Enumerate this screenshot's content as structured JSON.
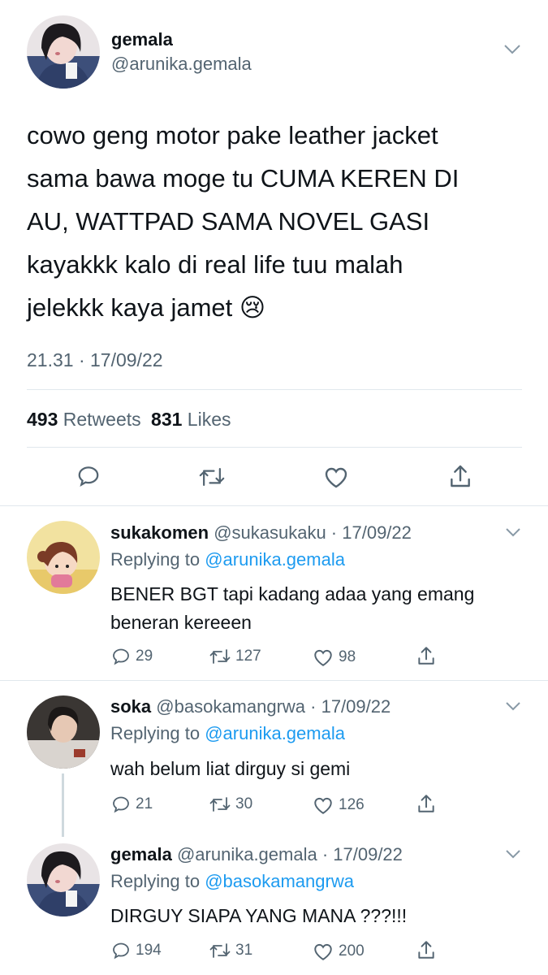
{
  "main_tweet": {
    "display_name": "gemala",
    "handle": "@arunika.gemala",
    "text_lines": [
      "cowo geng motor pake leather jacket",
      "sama bawa moge tu CUMA KEREN DI",
      "AU, WATTPAD SAMA NOVEL GASI",
      "kayakkk kalo di real life tuu malah",
      "jelekkk kaya jamet 😢"
    ],
    "timestamp": "21.31 · 17/09/22",
    "retweets_count": "493",
    "retweets_label": "Retweets",
    "likes_count": "831",
    "likes_label": "Likes",
    "icons": [
      "reply-icon",
      "retweet-icon",
      "like-icon",
      "share-icon"
    ]
  },
  "replies": [
    {
      "display_name": "sukakomen",
      "handle_date": "@sukasukaku · 17/09/22",
      "replying_prefix": "Replying to",
      "replying_to": "@arunika.gemala",
      "text_lines": [
        "BENER BGT tapi kadang adaa yang emang",
        "beneran kereeen"
      ],
      "reply_count": "29",
      "retweet_count": "127",
      "like_count": "98"
    },
    {
      "display_name": "soka",
      "handle_date": "@basokamangrwa · 17/09/22",
      "replying_prefix": "Replying to",
      "replying_to": "@arunika.gemala",
      "text_lines": [
        "wah belum liat dirguy si gemi"
      ],
      "reply_count": "21",
      "retweet_count": "30",
      "like_count": "126"
    },
    {
      "display_name": "gemala",
      "handle_date": "@arunika.gemala · 17/09/22",
      "replying_prefix": "Replying to",
      "replying_to": "@basokamangrwa",
      "text_lines": [
        "DIRGUY SIAPA YANG MANA ???!!!"
      ],
      "reply_count": "194",
      "retweet_count": "31",
      "like_count": "200"
    }
  ],
  "colors": {
    "accent": "#1d9bf0",
    "secondary_text": "#536471",
    "divider": "#e1e8ed"
  }
}
